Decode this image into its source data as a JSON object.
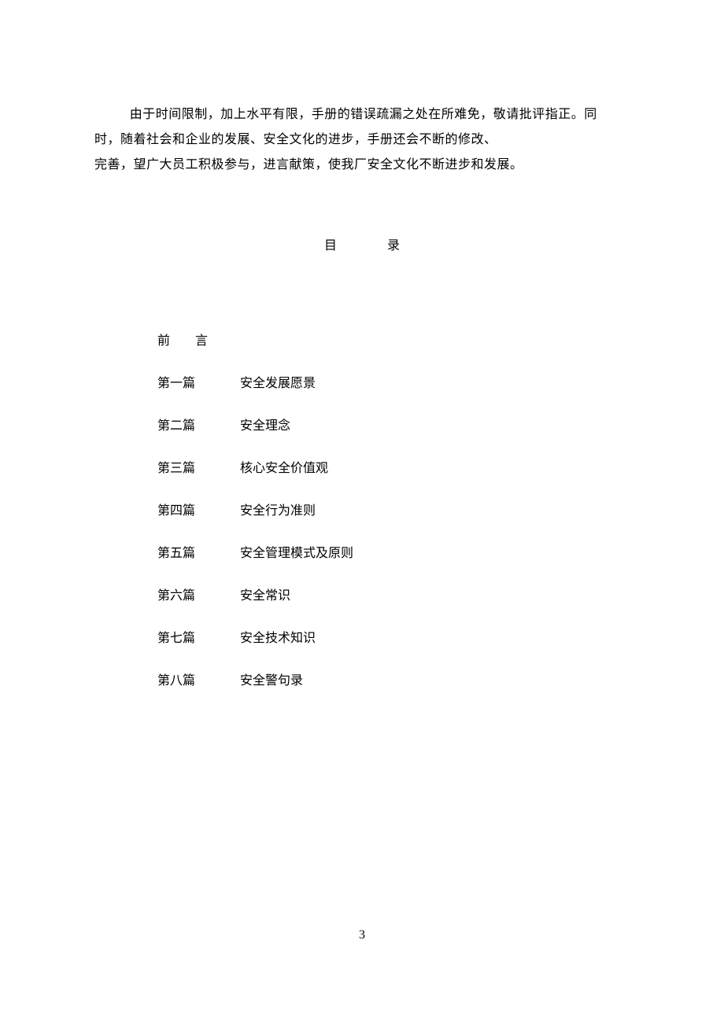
{
  "intro": {
    "line1": "由于时间限制，加上水平有限，手册的错误疏漏之处在所难免，敬请批评指正。同",
    "line2": "时，随着社会和企业的发展、安全文化的进步，手册还会不断的修改、",
    "line3": "完善，望广大员工积极参与，进言献策，使我厂安全文化不断进步和发展。"
  },
  "tocHeader": "目录",
  "toc": [
    {
      "label": "前言",
      "title": "",
      "spaced": true
    },
    {
      "label": "第一篇",
      "title": "安全发展愿景",
      "spaced": false
    },
    {
      "label": "第二篇",
      "title": "安全理念",
      "spaced": false
    },
    {
      "label": "第三篇",
      "title": "核心安全价值观",
      "spaced": false
    },
    {
      "label": "第四篇",
      "title": "安全行为准则",
      "spaced": false
    },
    {
      "label": "第五篇",
      "title": "安全管理模式及原则",
      "spaced": false
    },
    {
      "label": "第六篇",
      "title": "安全常识",
      "spaced": false
    },
    {
      "label": "第七篇",
      "title": "安全技术知识",
      "spaced": false
    },
    {
      "label": "第八篇",
      "title": "安全警句录",
      "spaced": false
    }
  ],
  "pageNumber": "3"
}
